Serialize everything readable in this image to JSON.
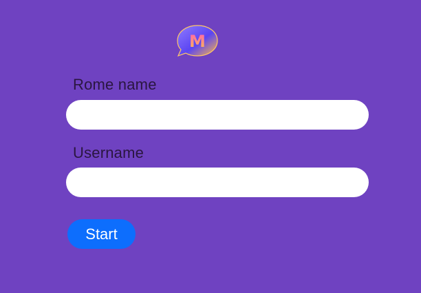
{
  "logo": {
    "icon": "chat-bubble-m-icon",
    "letter": "M"
  },
  "form": {
    "room_label": "Rome name",
    "room_value": "",
    "username_label": "Username",
    "username_value": "",
    "start_label": "Start"
  },
  "colors": {
    "background": "#6f42c1",
    "button": "#0d6efd",
    "input": "#ffffff",
    "label_text": "#2a1640"
  }
}
